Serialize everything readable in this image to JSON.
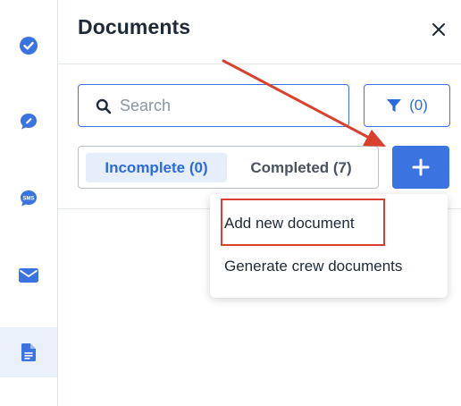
{
  "panel": {
    "title": "Documents"
  },
  "search": {
    "placeholder": "Search",
    "value": ""
  },
  "filter": {
    "count_label": "(0)"
  },
  "tabs": [
    {
      "label": "Incomplete (0)",
      "active": true
    },
    {
      "label": "Completed (7)",
      "active": false
    }
  ],
  "add_menu": {
    "items": [
      {
        "label": "Add new document"
      },
      {
        "label": "Generate crew documents"
      }
    ]
  },
  "rail": {
    "items": [
      {
        "icon": "check-circle-icon"
      },
      {
        "icon": "chat-pencil-icon"
      },
      {
        "icon": "sms-icon"
      },
      {
        "icon": "envelope-icon"
      },
      {
        "icon": "document-icon",
        "active": true
      }
    ]
  },
  "colors": {
    "accent": "#3b73e0",
    "annotation": "#d9402e"
  }
}
